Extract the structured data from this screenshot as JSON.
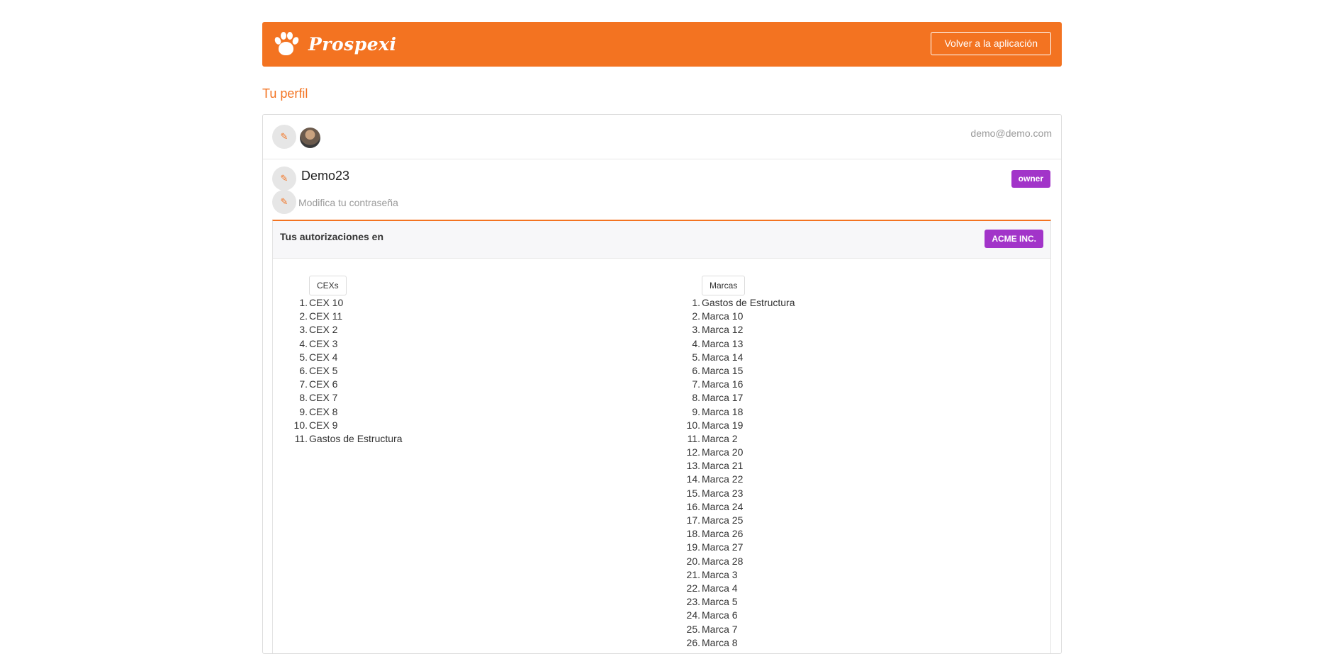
{
  "header": {
    "brand": "Prospexi",
    "back_button": "Volver a la aplicación"
  },
  "profile": {
    "title": "Tu perfil",
    "email": "demo@demo.com",
    "username": "Demo23",
    "role_badge": "owner",
    "change_password": "Modifica tu contraseña",
    "edit_icon": "edit-icon"
  },
  "authorizations": {
    "title": "Tus autorizaciones en",
    "org_badge": "ACME INC.",
    "cex": {
      "label": "CEXs",
      "items": [
        "CEX 10",
        "CEX 11",
        "CEX 2",
        "CEX 3",
        "CEX 4",
        "CEX 5",
        "CEX 6",
        "CEX 7",
        "CEX 8",
        "CEX 9",
        "Gastos de Estructura"
      ]
    },
    "marcas": {
      "label": "Marcas",
      "items": [
        "Gastos de Estructura",
        "Marca 10",
        "Marca 12",
        "Marca 13",
        "Marca 14",
        "Marca 15",
        "Marca 16",
        "Marca 17",
        "Marca 18",
        "Marca 19",
        "Marca 2",
        "Marca 20",
        "Marca 21",
        "Marca 22",
        "Marca 23",
        "Marca 24",
        "Marca 25",
        "Marca 26",
        "Marca 27",
        "Marca 28",
        "Marca 3",
        "Marca 4",
        "Marca 5",
        "Marca 6",
        "Marca 7",
        "Marca 8"
      ]
    }
  },
  "colors": {
    "accent": "#f37321",
    "badge": "#a234c9"
  }
}
